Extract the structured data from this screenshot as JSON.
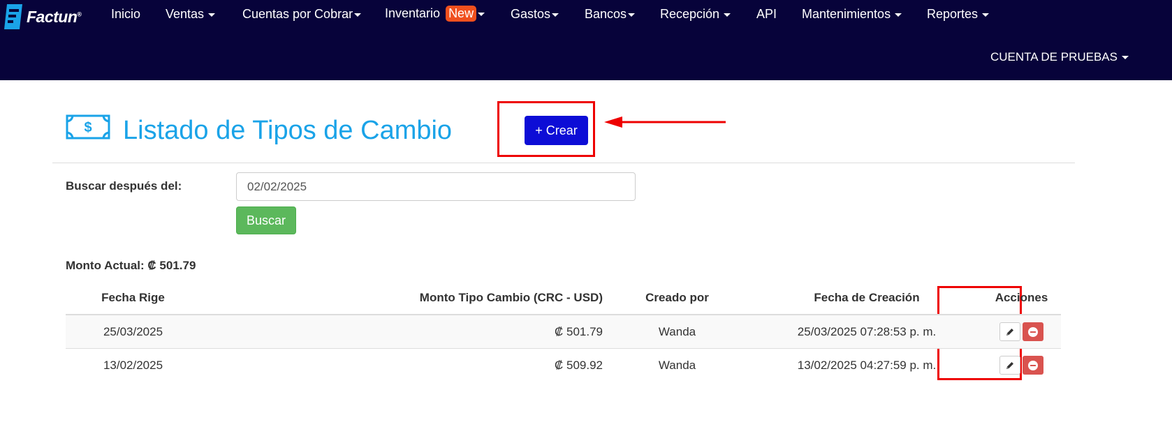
{
  "brand": {
    "name": "Factun",
    "mark": "®"
  },
  "nav": {
    "items": [
      {
        "label": "Inicio"
      },
      {
        "label": "Ventas"
      },
      {
        "label": "Cuentas por Cobrar"
      },
      {
        "label": "Inventario",
        "badge": "New"
      },
      {
        "label": "Gastos"
      },
      {
        "label": "Bancos"
      },
      {
        "label": "Recepción"
      },
      {
        "label": "API"
      },
      {
        "label": "Mantenimientos"
      },
      {
        "label": "Reportes"
      }
    ],
    "account": "CUENTA DE PRUEBAS"
  },
  "page": {
    "title": "Listado de Tipos de Cambio",
    "create_label": "+ Crear",
    "icon": "money-bill-icon"
  },
  "search": {
    "label": "Buscar después del:",
    "value": "02/02/2025",
    "button_label": "Buscar"
  },
  "monto_actual": "Monto Actual: ₡ 501.79",
  "table": {
    "headers": [
      "Fecha Rige",
      "Monto Tipo Cambio (CRC - USD)",
      "Creado por",
      "Fecha de Creación",
      "Acciones"
    ],
    "rows": [
      {
        "fecha_rige": "25/03/2025",
        "monto": "₡ 501.79",
        "creado_por": "Wanda",
        "fecha_creacion": "25/03/2025 07:28:53 p. m."
      },
      {
        "fecha_rige": "13/02/2025",
        "monto": "₡ 509.92",
        "creado_por": "Wanda",
        "fecha_creacion": "13/02/2025 04:27:59 p. m."
      }
    ]
  },
  "colors": {
    "navbar": "#07033a",
    "title": "#1aa3e8",
    "create_button": "#0d0dd6",
    "search_button": "#5cb85c",
    "delete_button": "#d9534f",
    "annotation": "#ee0000",
    "new_badge": "#f0501e"
  }
}
